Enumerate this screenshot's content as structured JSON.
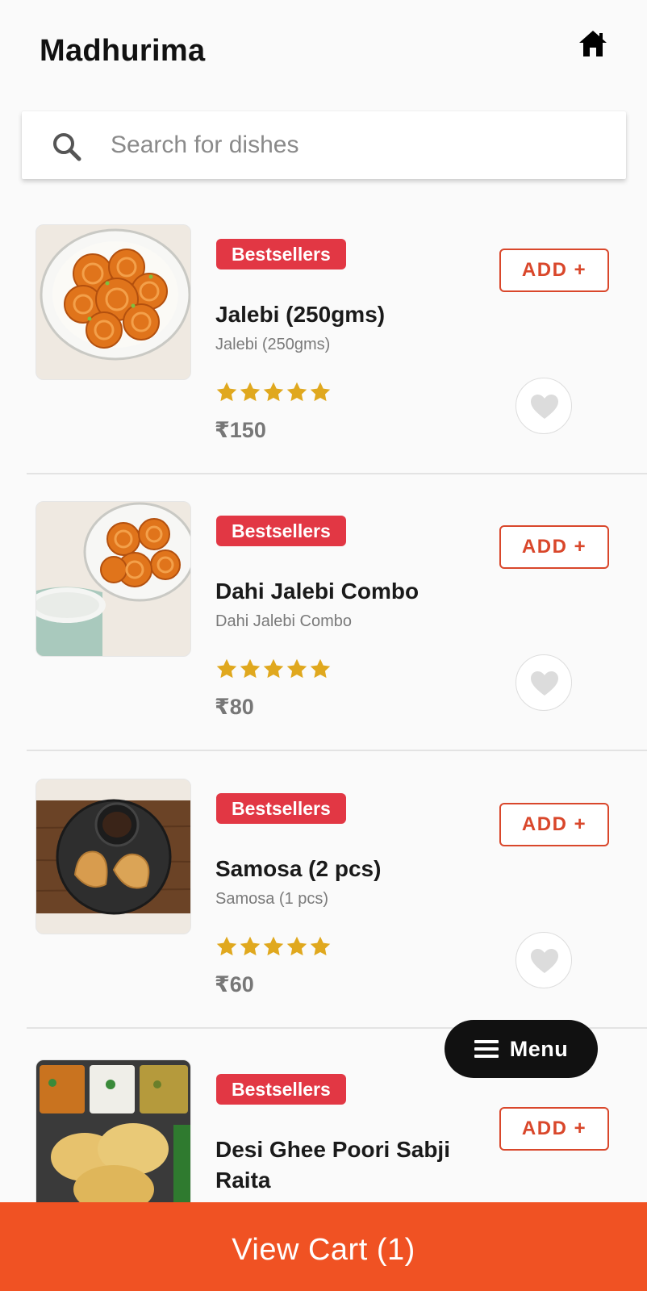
{
  "app": {
    "title": "Madhurima"
  },
  "search": {
    "placeholder": "Search for dishes"
  },
  "items": [
    {
      "badge": "Bestsellers",
      "name": "Jalebi (250gms)",
      "description": "Jalebi (250gms)",
      "rating": 5,
      "price": "₹150",
      "add_label": "ADD +",
      "image": "jalebi"
    },
    {
      "badge": "Bestsellers",
      "name": "Dahi Jalebi Combo",
      "description": "Dahi Jalebi Combo",
      "rating": 5,
      "price": "₹80",
      "add_label": "ADD +",
      "image": "dahi-jalebi"
    },
    {
      "badge": "Bestsellers",
      "name": "Samosa (2 pcs)",
      "description": "Samosa (1 pcs)",
      "rating": 5,
      "price": "₹60",
      "add_label": "ADD +",
      "image": "samosa"
    },
    {
      "badge": "Bestsellers",
      "name": "Desi Ghee Poori Sabji Raita",
      "add_label": "ADD +",
      "image": "poori-thali"
    }
  ],
  "menu_button": {
    "label": "Menu"
  },
  "cart": {
    "label": "View Cart (1)"
  },
  "colors": {
    "accent": "#f05223",
    "badge": "#e23744",
    "add_border": "#d9472b",
    "star": "#e0a81e"
  }
}
